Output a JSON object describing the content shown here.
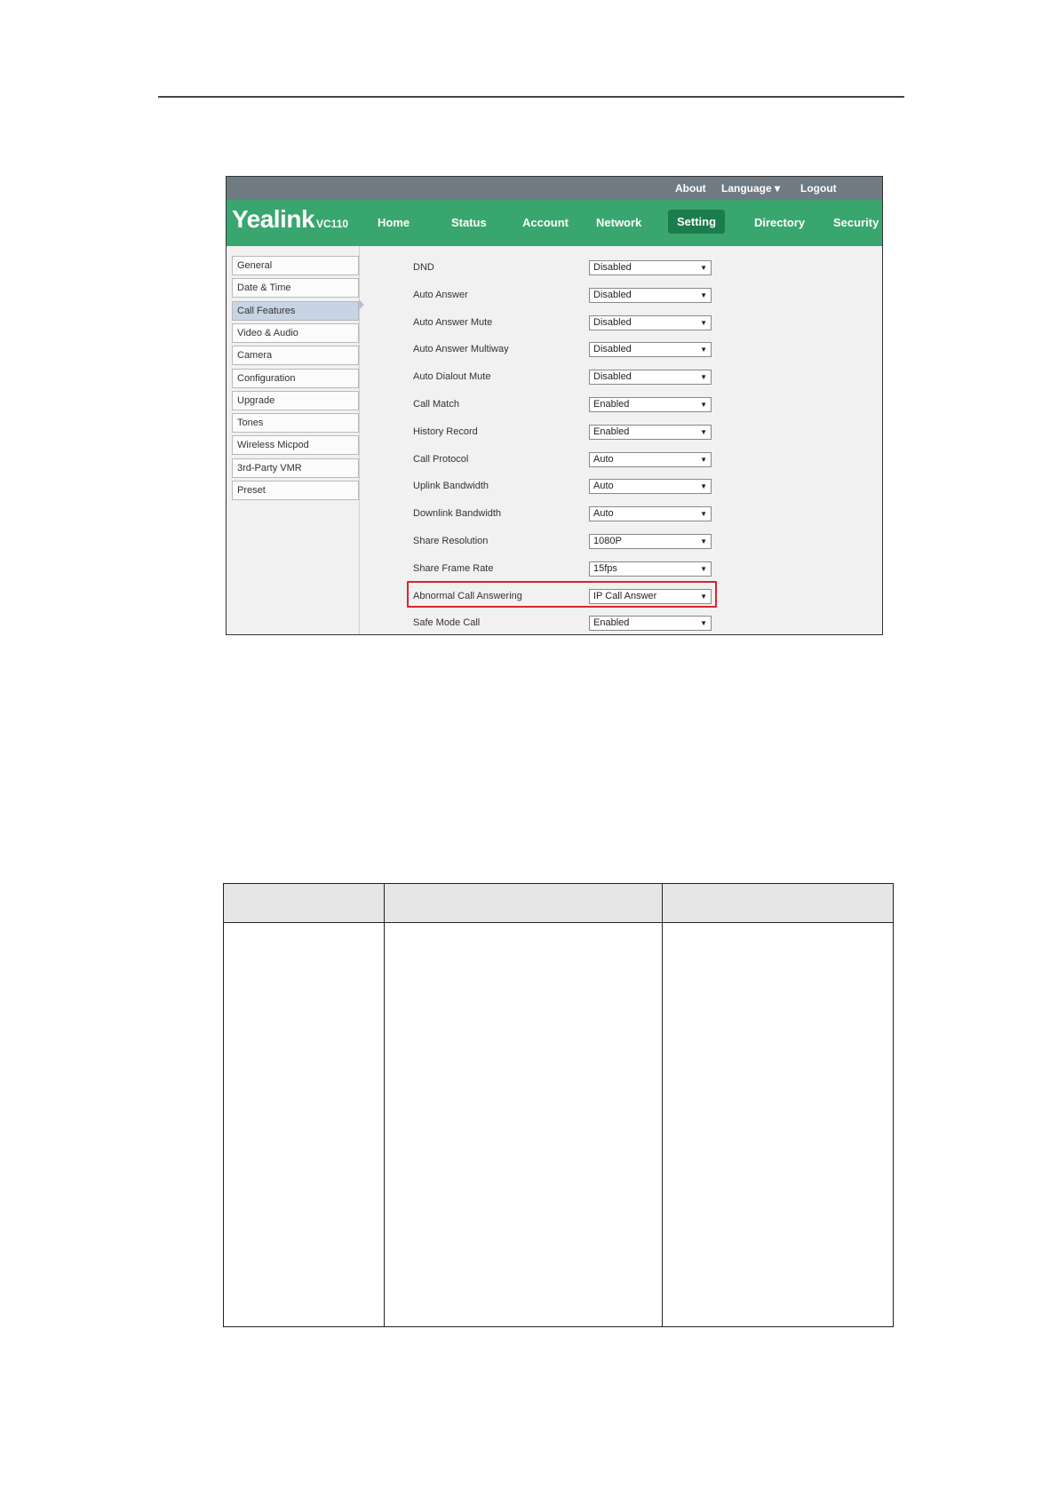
{
  "utility_bar": {
    "about": "About",
    "language": "Language ▾",
    "logout": "Logout"
  },
  "logo": {
    "brand": "Yealink",
    "model": "VC110"
  },
  "nav": {
    "home": "Home",
    "status": "Status",
    "account": "Account",
    "network": "Network",
    "setting": "Setting",
    "directory": "Directory",
    "security": "Security",
    "active": "Setting"
  },
  "sidebar": {
    "items": [
      "General",
      "Date & Time",
      "Call Features",
      "Video & Audio",
      "Camera",
      "Configuration",
      "Upgrade",
      "Tones",
      "Wireless Micpod",
      "3rd-Party VMR",
      "Preset"
    ],
    "active": "Call Features"
  },
  "fields": [
    {
      "label": "DND",
      "value": "Disabled"
    },
    {
      "label": "Auto Answer",
      "value": "Disabled"
    },
    {
      "label": "Auto Answer Mute",
      "value": "Disabled"
    },
    {
      "label": "Auto Answer Multiway",
      "value": "Disabled"
    },
    {
      "label": "Auto Dialout Mute",
      "value": "Disabled"
    },
    {
      "label": "Call Match",
      "value": "Enabled"
    },
    {
      "label": "History Record",
      "value": "Enabled"
    },
    {
      "label": "Call Protocol",
      "value": "Auto"
    },
    {
      "label": "Uplink Bandwidth",
      "value": "Auto"
    },
    {
      "label": "Downlink Bandwidth",
      "value": "Auto"
    },
    {
      "label": "Share Resolution",
      "value": "1080P"
    },
    {
      "label": "Share Frame Rate",
      "value": "15fps"
    },
    {
      "label": "Abnormal Call Answering",
      "value": "IP Call Answer"
    },
    {
      "label": "Safe Mode Call",
      "value": "Enabled"
    }
  ],
  "highlighted_field": "Abnormal Call Answering",
  "colors": {
    "nav_green": "#3aa66f",
    "nav_active": "#1b7c4c",
    "utility_gray": "#6f7a83",
    "highlight_red": "#d9262e"
  }
}
